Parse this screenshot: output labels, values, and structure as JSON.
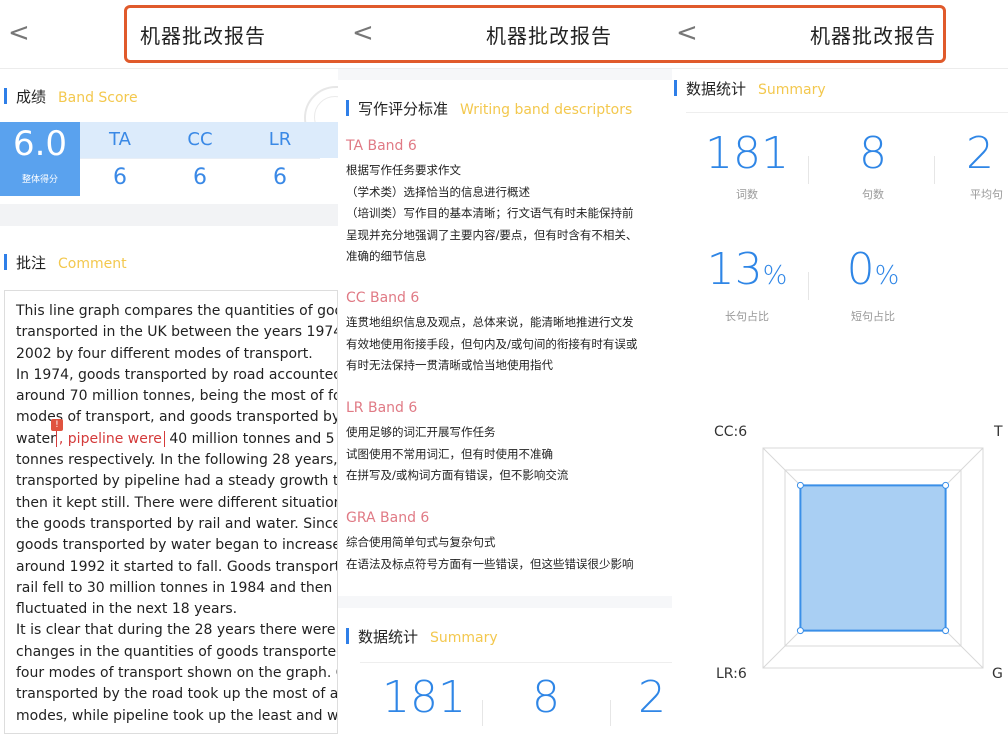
{
  "nav": {
    "back_glyph": "<",
    "title": "机器批改报告"
  },
  "panel1": {
    "score_section": {
      "title": "成绩",
      "subtitle_en": "Band Score"
    },
    "overall": {
      "value": "6.0",
      "label": "整体得分"
    },
    "criteria": [
      {
        "code": "TA",
        "score": "6"
      },
      {
        "code": "CC",
        "score": "6"
      },
      {
        "code": "LR",
        "score": "6"
      }
    ],
    "comment_section": {
      "title": "批注",
      "subtitle_en": "Comment"
    },
    "comment": {
      "lines": [
        "This line graph compares the quantities of goo",
        "transported in the UK between the years 1974",
        "2002 by four different modes of transport.",
        "In 1974, goods transported by road accounted",
        "around 70 million tonnes, being the most of fou",
        "modes of transport, and goods transported by"
      ],
      "line7_before": "water",
      "line7_highlight": ", pipeline were",
      "line7_after": " 40 million tonnes and 5 m",
      "marker": "!",
      "lines_rest": [
        "tonnes respectively. In the following 28 years, g",
        "transported by pipeline had a steady growth till",
        "then it kept still. There were different situations",
        "the goods transported by rail and water. Since",
        "goods transported by water began to increase",
        "around 1992 it started to fall. Goods transporte",
        "rail fell to 30 million tonnes in 1984 and then it",
        "fluctuated in the next 18 years.",
        "It is clear that during the 28 years there were s",
        "changes in the quantities of goods transported",
        "four modes of transport shown on the graph. G",
        "transported by the road took up the most of all",
        "modes, while pipeline took up the least and was"
      ]
    }
  },
  "panel2": {
    "section": {
      "title": "写作评分标准",
      "subtitle_en": "Writing band descriptors"
    },
    "bands": [
      {
        "title": "TA Band 6",
        "lines": [
          "根据写作任务要求作文",
          "（学术类）选择恰当的信息进行概述",
          "（培训类）写作目的基本清晰；行文语气有时未能保持前",
          "呈现并充分地强调了主要内容/要点，但有时含有不相关、",
          "准确的细节信息"
        ]
      },
      {
        "title": "CC Band 6",
        "lines": [
          "连贯地组织信息及观点，总体来说，能清晰地推进行文发",
          "有效地使用衔接手段，但句内及/或句间的衔接有时有误或",
          "有时无法保持一贯清晰或恰当地使用指代"
        ]
      },
      {
        "title": "LR Band 6",
        "lines": [
          "使用足够的词汇开展写作任务",
          "试图使用不常用词汇，但有时使用不准确",
          "在拼写及/或构词方面有错误，但不影响交流"
        ]
      },
      {
        "title": "GRA Band 6",
        "lines": [
          "综合使用简单句式与复杂句式",
          "在语法及标点符号方面有一些错误，但这些错误很少影响"
        ]
      }
    ],
    "stats_section": {
      "title": "数据统计",
      "subtitle_en": "Summary"
    },
    "stats": [
      "181",
      "8",
      "2"
    ]
  },
  "panel3": {
    "section": {
      "title": "数据统计",
      "subtitle_en": "Summary"
    },
    "stats": [
      {
        "value": "181",
        "unit": "",
        "label": "词数"
      },
      {
        "value": "8",
        "unit": "",
        "label": "句数"
      },
      {
        "value": "2",
        "unit": "",
        "label": "平均句"
      }
    ],
    "ratios": [
      {
        "value": "13",
        "unit": "%",
        "label": "长句占比"
      },
      {
        "value": "0",
        "unit": "%",
        "label": "短句占比"
      }
    ],
    "radar": {
      "labels": {
        "cc": "CC:6",
        "ta": "T",
        "lr": "LR:6",
        "gra": "G"
      },
      "colors": {
        "fill": "#a9cff3",
        "stroke": "#3a8fe8",
        "grid": "#d8d8d8"
      }
    }
  }
}
